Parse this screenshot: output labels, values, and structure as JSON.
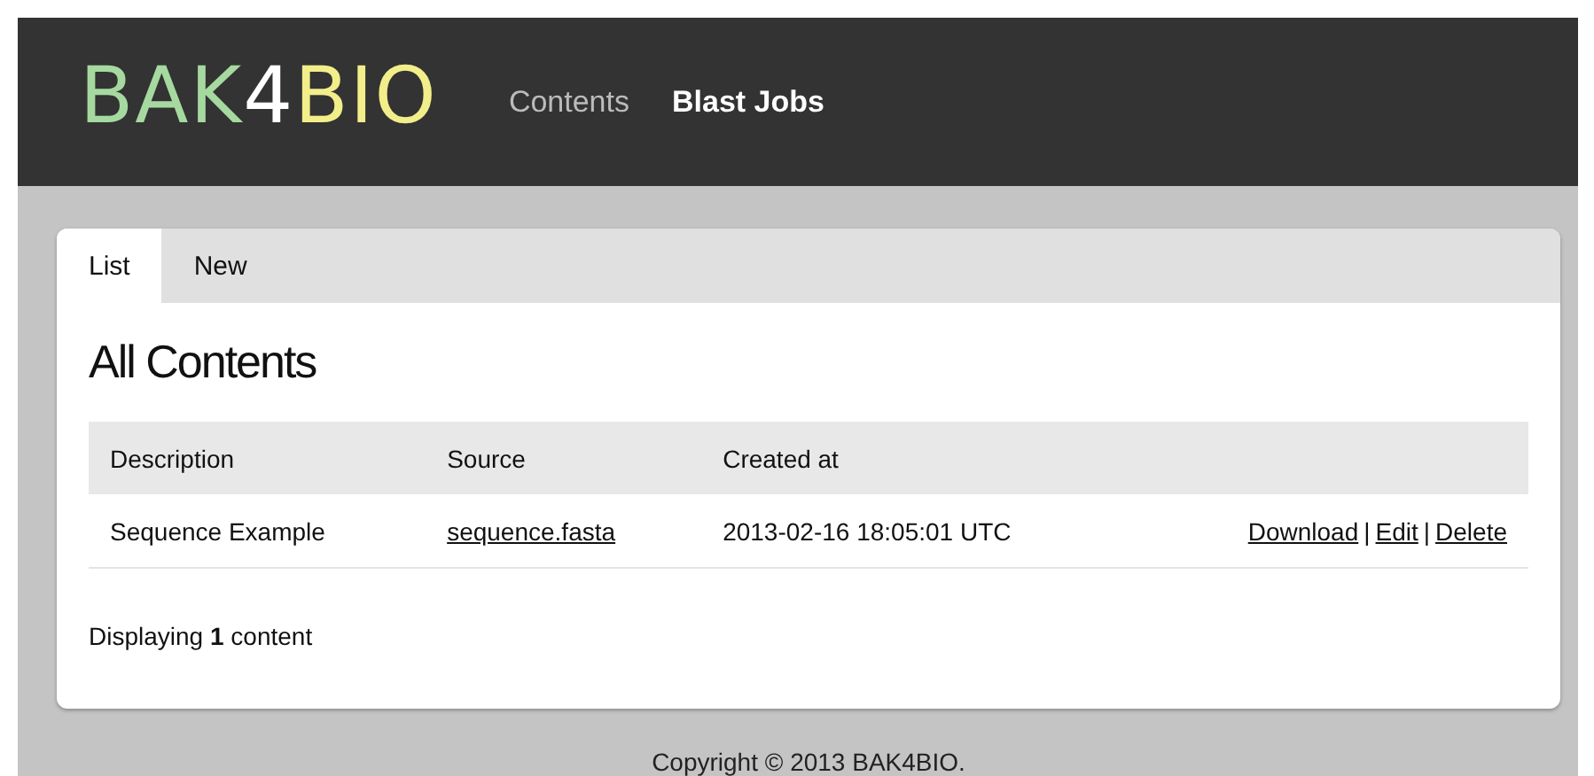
{
  "logo": [
    {
      "text": "BAK",
      "color": "#a6d9a0"
    },
    {
      "text": "4",
      "color": "#ffffff"
    },
    {
      "text": "BIO",
      "color": "#f2ee8a"
    }
  ],
  "nav": [
    {
      "label": "Contents",
      "selected": false
    },
    {
      "label": "Blast Jobs",
      "selected": true
    }
  ],
  "tabs": [
    {
      "label": "List",
      "selected": true
    },
    {
      "label": "New",
      "selected": false
    }
  ],
  "heading": "All Contents",
  "table": {
    "columns": [
      "Description",
      "Source",
      "Created at"
    ],
    "rows": [
      {
        "description": "Sequence Example",
        "source": "sequence.fasta",
        "created_at": "2013-02-16 18:05:01 UTC",
        "actions": [
          "Download",
          "Edit",
          "Delete"
        ]
      }
    ],
    "action_separator": "|"
  },
  "summary": "Displaying **1** content",
  "footer": "Copyright © 2013 BAK4BIO."
}
